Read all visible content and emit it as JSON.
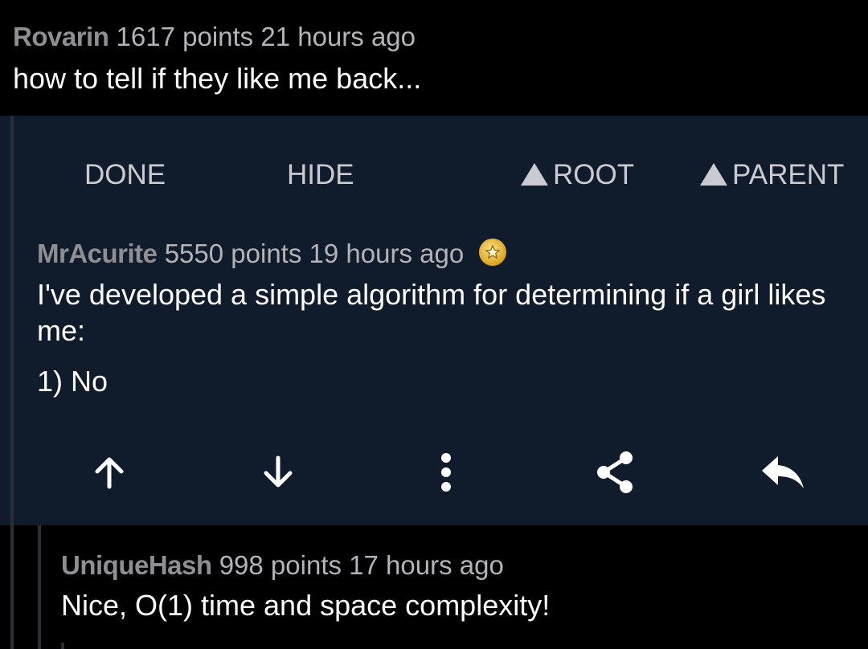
{
  "parent_comment": {
    "author": "Rovarin",
    "points": "1617 points",
    "time": "21 hours ago",
    "body": "how to tell if they like me back..."
  },
  "action_bar": {
    "done": "DONE",
    "hide": "HIDE",
    "root": "ROOT",
    "parent": "PARENT"
  },
  "selected_comment": {
    "author": "MrAcurite",
    "points": "5550 points",
    "time": "19 hours ago",
    "award_icon": "gold-award-icon",
    "body": "I've developed a simple algorithm for determining if a girl likes me:",
    "list_item": "1) No"
  },
  "comment_actions": [
    "upvote-icon",
    "downvote-icon",
    "more-options-icon",
    "share-icon",
    "reply-icon"
  ],
  "child_comment": {
    "author": "UniqueHash",
    "points": "998 points",
    "time": "17 hours ago",
    "body": "Nice, O(1) time and space complexity!"
  },
  "colors": {
    "background": "#000000",
    "selected_background": "#101b2c",
    "author": "#8e8e93",
    "meta": "#b4b4b8",
    "text": "#ffffff",
    "action": "#c9cbd0",
    "award": "#d9a21c"
  }
}
